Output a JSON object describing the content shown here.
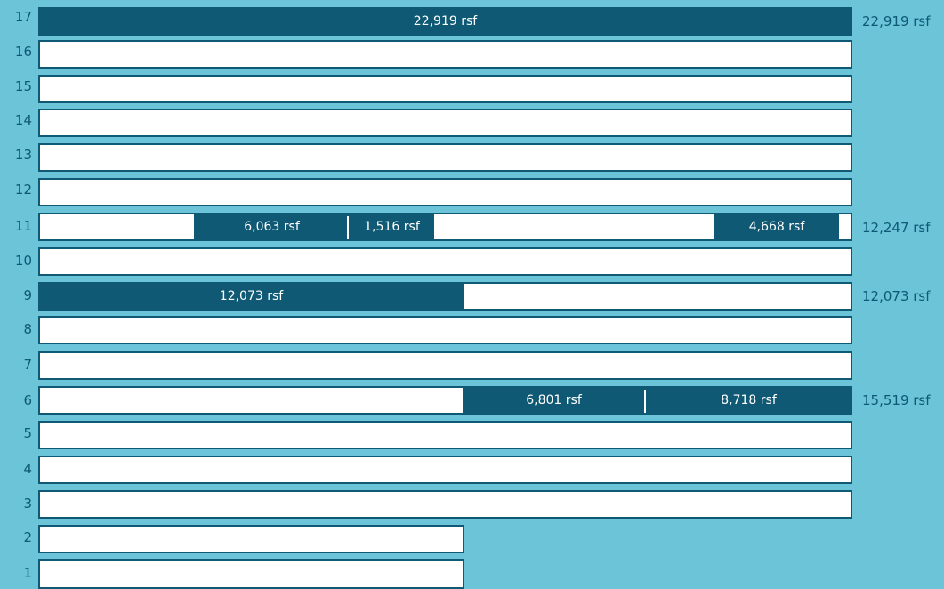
{
  "building": {
    "floors": [
      {
        "id": "17",
        "label": "17",
        "total": "22,919 rsf",
        "segments": [
          {
            "label": "22,919 rsf"
          }
        ]
      },
      {
        "id": "16",
        "label": "16"
      },
      {
        "id": "15",
        "label": "15"
      },
      {
        "id": "14",
        "label": "14"
      },
      {
        "id": "13",
        "label": "13"
      },
      {
        "id": "12",
        "label": "12"
      },
      {
        "id": "11",
        "label": "11",
        "total": "12,247 rsf",
        "segments": [
          {
            "label": "6,063 rsf"
          },
          {
            "label": "1,516 rsf"
          },
          {
            "label": "4,668 rsf"
          }
        ]
      },
      {
        "id": "10",
        "label": "10"
      },
      {
        "id": "9",
        "label": "9",
        "total": "12,073 rsf",
        "segments": [
          {
            "label": "12,073 rsf"
          }
        ]
      },
      {
        "id": "8",
        "label": "8"
      },
      {
        "id": "7",
        "label": "7"
      },
      {
        "id": "6",
        "label": "6",
        "total": "15,519 rsf",
        "segments": [
          {
            "label": "6,801 rsf"
          },
          {
            "label": "8,718 rsf"
          }
        ]
      },
      {
        "id": "5",
        "label": "5"
      },
      {
        "id": "4",
        "label": "4"
      },
      {
        "id": "3",
        "label": "3"
      },
      {
        "id": "2",
        "label": "2"
      },
      {
        "id": "1",
        "label": "1"
      }
    ]
  },
  "colors": {
    "background": "#6bc4d7",
    "available_space": "#0f5974",
    "floor_plate": "#ffffff",
    "text_on_fill": "#ffffff"
  }
}
